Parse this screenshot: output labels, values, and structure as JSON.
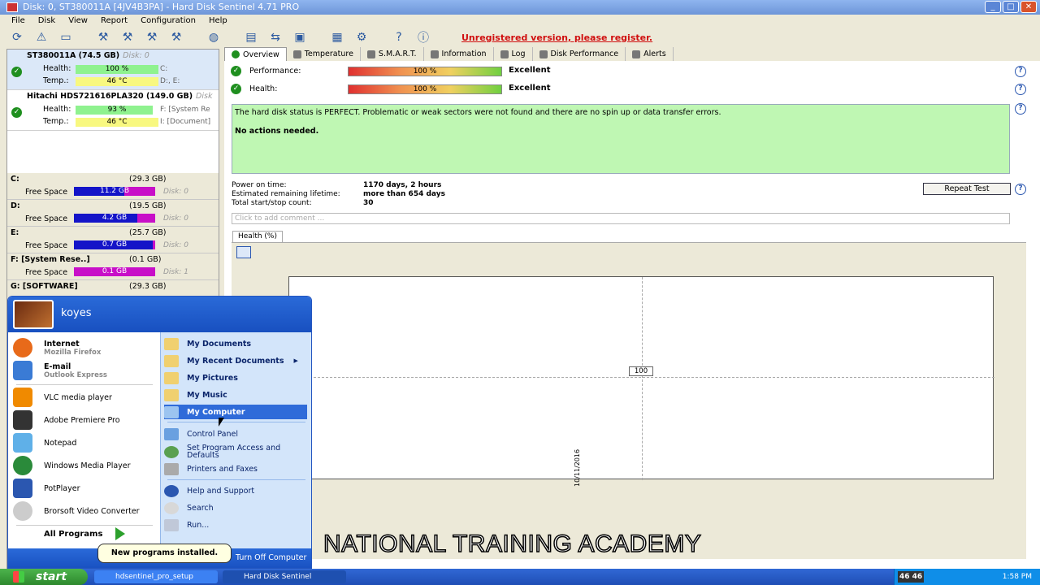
{
  "window": {
    "title": "Disk: 0, ST380011A [4JV4B3PA]  -  Hard Disk Sentinel 4.71 PRO"
  },
  "menu": [
    "File",
    "Disk",
    "View",
    "Report",
    "Configuration",
    "Help"
  ],
  "toolbar": {
    "unregistered": "Unregistered version, please register."
  },
  "disks": [
    {
      "name": "ST380011A (74.5 GB)",
      "num": "Disk: 0",
      "health_label": "Health:",
      "health": "100 %",
      "health_pct": 100,
      "temp_label": "Temp.:",
      "temp": "46 °C",
      "side1": "C:",
      "side2": "D:, E:"
    },
    {
      "name": "Hitachi HDS721616PLA320 (149.0 GB)",
      "num": "Disk",
      "health_label": "Health:",
      "health": "93 %",
      "health_pct": 93,
      "temp_label": "Temp.:",
      "temp": "46 °C",
      "side1": "F: [System Re",
      "side2": "I: [Document]"
    }
  ],
  "partitions": [
    {
      "name": "C:",
      "size": "(29.3 GB)",
      "free_label": "Free Space",
      "free": "11.2 GB",
      "used_frac": 0.62,
      "disk": "Disk: 0"
    },
    {
      "name": "D:",
      "size": "(19.5 GB)",
      "free_label": "Free Space",
      "free": "4.2 GB",
      "used_frac": 0.78,
      "disk": "Disk: 0"
    },
    {
      "name": "E:",
      "size": "(25.7 GB)",
      "free_label": "Free Space",
      "free": "0.7 GB",
      "used_frac": 0.97,
      "disk": "Disk: 0"
    },
    {
      "name": "F: [System Rese..]",
      "size": "(0.1 GB)",
      "free_label": "Free Space",
      "free": "0.1 GB",
      "used_frac": 0.0,
      "disk": "Disk: 1"
    },
    {
      "name": "G: [SOFTWARE]",
      "size": "(29.3 GB)",
      "free_label": "",
      "free": "",
      "used_frac": 0,
      "disk": ""
    }
  ],
  "tabs": [
    "Overview",
    "Temperature",
    "S.M.A.R.T.",
    "Information",
    "Log",
    "Disk Performance",
    "Alerts"
  ],
  "overview": {
    "performance_label": "Performance:",
    "performance_value": "100 %",
    "performance_text": "Excellent",
    "health_label": "Health:",
    "health_value": "100 %",
    "health_text": "Excellent",
    "status_line": "The hard disk status is PERFECT. Problematic or weak sectors were not found and there are no spin up or data transfer errors.",
    "actions": "No actions needed.",
    "power_on_label": "Power on time:",
    "power_on": "1170 days, 2 hours",
    "lifetime_label": "Estimated remaining lifetime:",
    "lifetime": "more than 654 days",
    "startstop_label": "Total start/stop count:",
    "startstop": "30",
    "repeat_test": "Repeat Test",
    "comment_placeholder": "Click to add comment ...",
    "chart_tab": "Health (%)"
  },
  "chart_data": {
    "type": "line",
    "series": [
      {
        "values": [
          100
        ]
      }
    ],
    "x": [
      "10/11/2016"
    ],
    "point_label": "100"
  },
  "startmenu": {
    "user": "koyes",
    "pinned": [
      {
        "label": "Internet",
        "sub": "Mozilla Firefox",
        "color": "#e86a1a"
      },
      {
        "label": "E-mail",
        "sub": "Outlook Express",
        "color": "#3a7bd5"
      }
    ],
    "recent": [
      {
        "label": "VLC media player",
        "color": "#f08a00"
      },
      {
        "label": "Adobe Premiere Pro",
        "color": "#333333"
      },
      {
        "label": "Notepad",
        "color": "#5fb0e8"
      },
      {
        "label": "Windows Media Player",
        "color": "#2a8a3a"
      },
      {
        "label": "PotPlayer",
        "color": "#2b57b0"
      },
      {
        "label": "Brorsoft Video Converter",
        "color": "#cccccc"
      }
    ],
    "all_programs": "All Programs",
    "right": [
      "My Documents",
      "My Recent Documents",
      "My Pictures",
      "My Music",
      "My Computer",
      "Control Panel",
      "Set Program Access and Defaults",
      "Printers and Faxes",
      "Help and Support",
      "Search",
      "Run..."
    ],
    "turn_off": "Turn Off Computer",
    "balloon": "New programs installed."
  },
  "overlay_text": "NATIONAL TRAINING ACADEMY",
  "taskbar": {
    "start": "start",
    "tasks": [
      "hdsentinel_pro_setup",
      "Hard Disk Sentinel"
    ],
    "lang": "46 46",
    "clock": "1:58 PM"
  }
}
